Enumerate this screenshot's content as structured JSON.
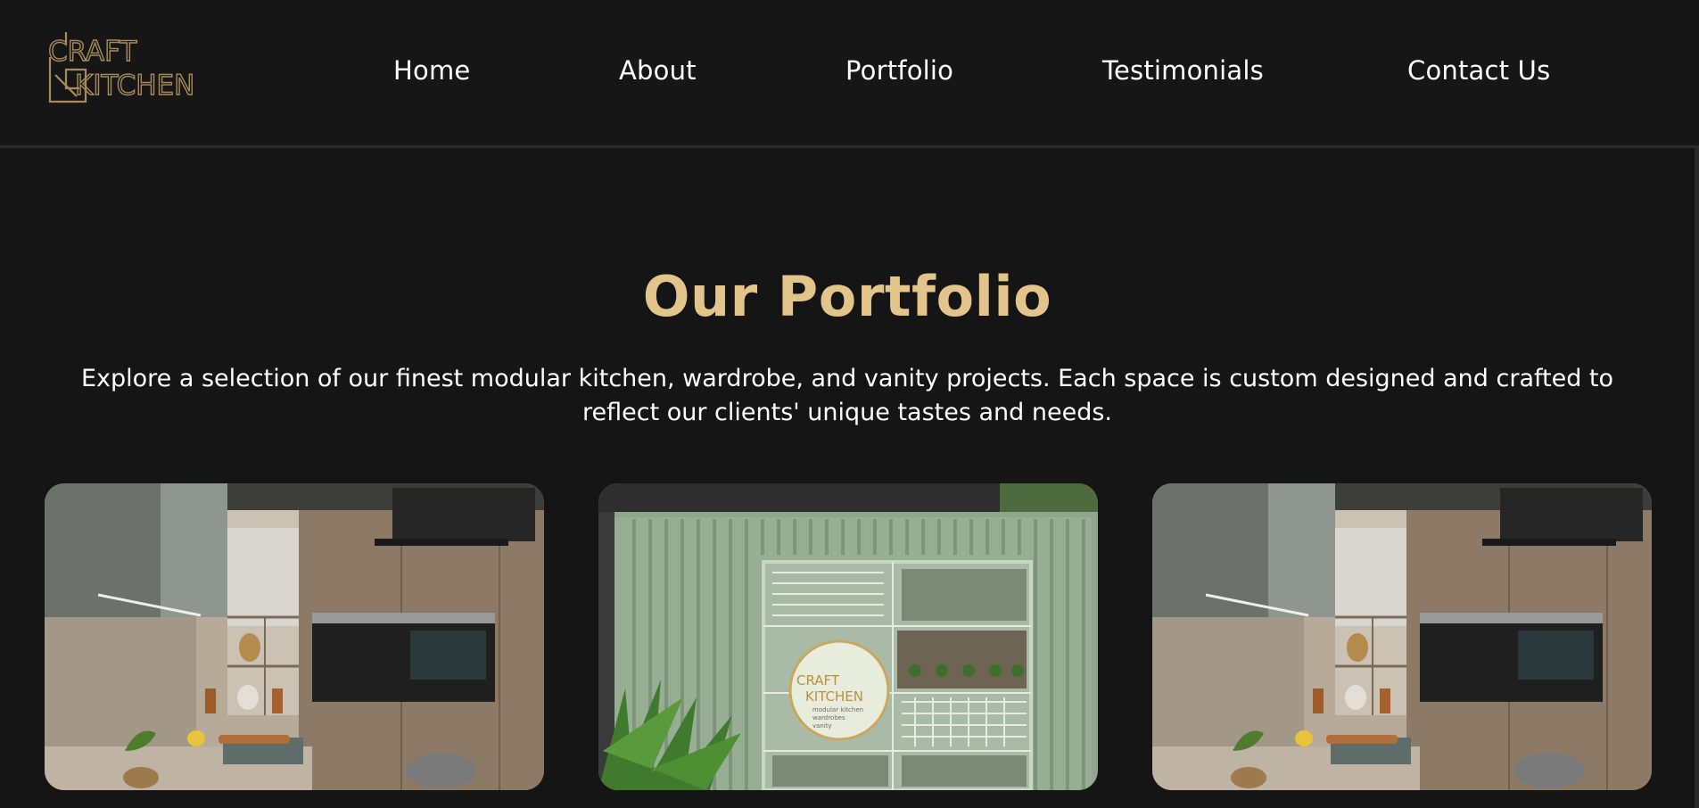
{
  "brand": {
    "logo_line1": "CRAFT",
    "logo_line2": "KITCHEN",
    "gold": "#a98a5c"
  },
  "nav": {
    "items": [
      {
        "label": "Home"
      },
      {
        "label": "About"
      },
      {
        "label": "Portfolio"
      },
      {
        "label": "Testimonials"
      },
      {
        "label": "Contact Us"
      }
    ]
  },
  "portfolio": {
    "title": "Our Portfolio",
    "intro": "Explore a selection of our finest modular kitchen, wardrobe, and vanity projects. Each space is custom designed and crafted to reflect our clients' unique tastes and needs.",
    "title_color": "#e3c48a",
    "projects": [
      {
        "image": "modular-kitchen-photo"
      },
      {
        "image": "craft-kitchen-showroom-facade-photo",
        "sign_line1": "CRAFT",
        "sign_line2": "KITCHEN",
        "sign_line3": "modular kitchen",
        "sign_line4": "wardrobes",
        "sign_line5": "vanity"
      },
      {
        "image": "modular-kitchen-photo"
      }
    ]
  }
}
